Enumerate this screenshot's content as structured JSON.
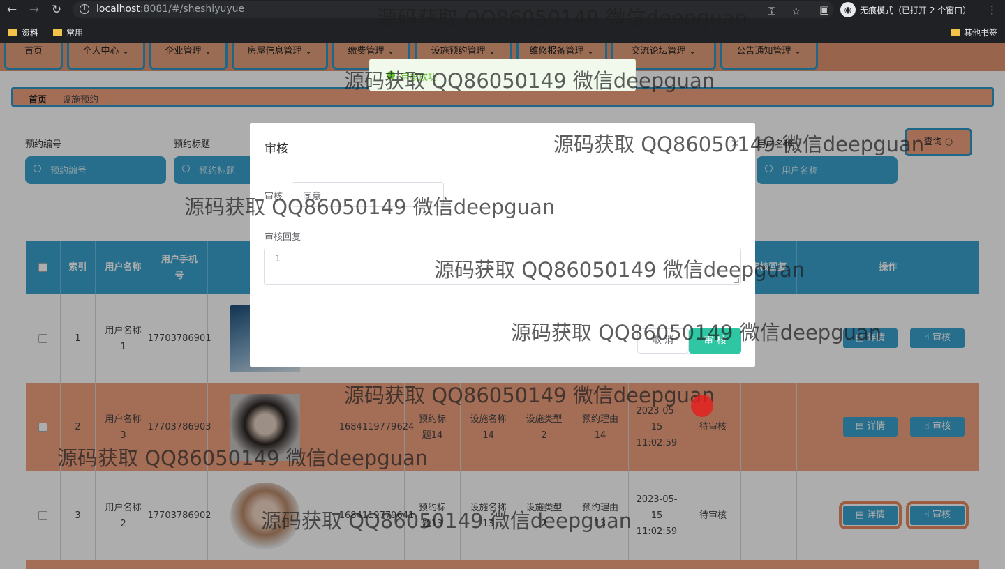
{
  "browser": {
    "url_host": "localhost",
    "url_port_path": ":8081/#/sheshiyuyue",
    "incognito_text": "无痕模式（已打开 2 个窗口）",
    "bookmarks": [
      "资料",
      "常用"
    ],
    "bookmarks_right": "其他书签"
  },
  "nav": {
    "items": [
      "首页",
      "个人中心",
      "企业管理",
      "房屋信息管理",
      "缴费管理",
      "设施预约管理",
      "维修报备管理",
      "交流论坛管理",
      "公告通知管理"
    ]
  },
  "breadcrumb": {
    "home": "首页",
    "current": "设施预约"
  },
  "filters": {
    "booking_no_label": "预约编号",
    "booking_no_placeholder": "预约编号",
    "booking_title_label": "预约标题",
    "booking_title_placeholder": "预约标题",
    "username_label": "用户名称",
    "username_placeholder": "用户名称",
    "query_button": "查询"
  },
  "table": {
    "headers": {
      "index": "索引",
      "username": "用户名称",
      "phone": "用户手机号",
      "review_reply": "审核回复",
      "actions": "操作"
    },
    "rows": [
      {
        "index": "1",
        "username": "用户名称1",
        "phone": "17703786901",
        "no": "",
        "title": "",
        "facility": "",
        "type": "",
        "reason": "",
        "time": "",
        "status": ""
      },
      {
        "index": "2",
        "username": "用户名称3",
        "phone": "17703786903",
        "no": "1684119779624",
        "title": "预约标题14",
        "facility": "设施名称14",
        "type": "设施类型2",
        "reason": "预约理由14",
        "time": "2023-05-15 11:02:59",
        "status": "待审核"
      },
      {
        "index": "3",
        "username": "用户名称2",
        "phone": "17703786902",
        "no": "1684119779641",
        "title": "预约标题13",
        "facility": "设施名称13",
        "type": "设施类型2",
        "reason": "预约理由13",
        "time": "2023-05-15 11:02:59",
        "status": "待审核"
      }
    ],
    "detail_button": "详情",
    "review_button": "审核"
  },
  "toast": {
    "message": "审核成功"
  },
  "dialog": {
    "title": "审核",
    "review_label": "审核",
    "review_value": "同意",
    "reply_label": "审核回复",
    "reply_value": "1",
    "cancel_button": "取 消",
    "confirm_button": "审 核"
  },
  "watermark": "源码获取 QQ86050149 微信deepguan",
  "colors": {
    "accent_blue": "#3aa3cf",
    "accent_orange": "#e09670",
    "confirm_green": "#2fc6a3"
  }
}
